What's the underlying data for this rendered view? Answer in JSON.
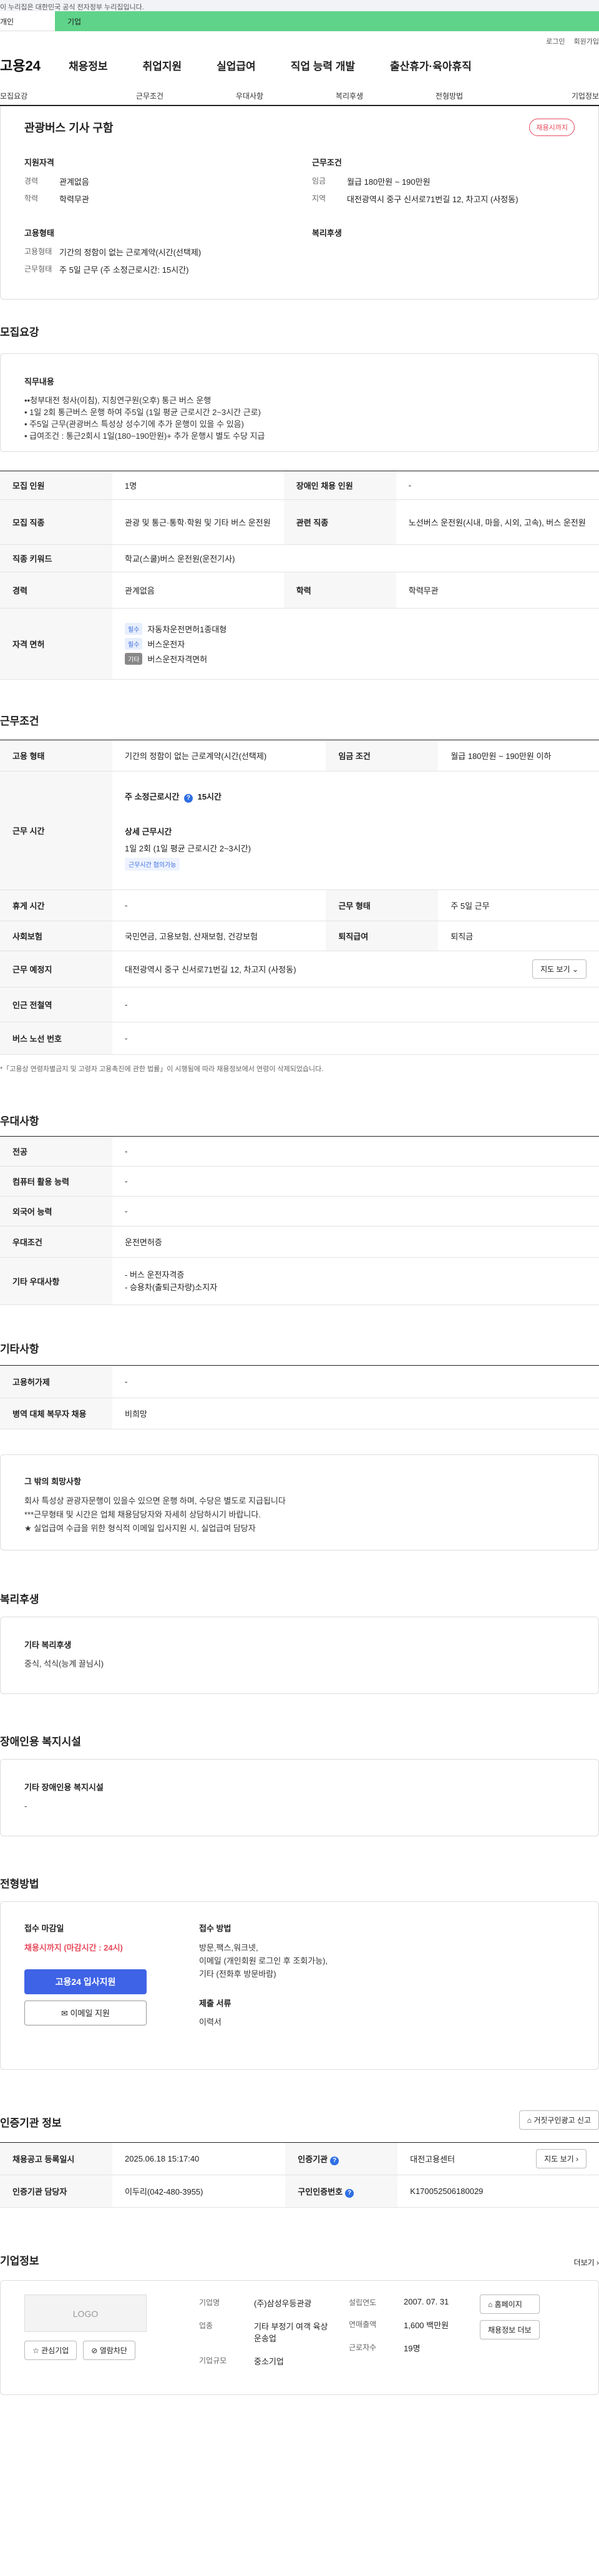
{
  "gov_banner": "이 누리집은 대한민국 공식 전자정부 누리집입니다.",
  "tabs": {
    "personal": "개인",
    "company": "기업"
  },
  "util": {
    "login": "로그인",
    "signup": "회원가입"
  },
  "logo": "고용24",
  "gnb": [
    "채용정보",
    "취업지원",
    "실업급여",
    "직업 능력 개발",
    "출산휴가·육아휴직"
  ],
  "subnav": [
    "모집요강",
    "근무조건",
    "우대사항",
    "복리후생",
    "전형방법",
    "기업정보"
  ],
  "summary": {
    "title": "관광버스 기사 구함",
    "status": "채용시까지",
    "qual": {
      "heading": "지원자격",
      "rows": [
        {
          "k": "경력",
          "v": "관계없음"
        },
        {
          "k": "학력",
          "v": "학력무관"
        }
      ]
    },
    "cond": {
      "heading": "근무조건",
      "rows": [
        {
          "k": "임금",
          "v": "월급 180만원 ~ 190만원"
        },
        {
          "k": "지역",
          "v": "대전광역시 중구 신서로71번길 12, 차고지 (사정동)"
        }
      ]
    },
    "emp": {
      "heading": "고용형태",
      "rows": [
        {
          "k": "고용형태",
          "v": "기간의 정함이 없는 근로계약(시간(선택제)"
        },
        {
          "k": "근무형태",
          "v": "주 5일 근무 (주 소정근로시간: 15시간)"
        }
      ]
    },
    "welfare": {
      "heading": "복리후생"
    }
  },
  "recruit": {
    "heading": "모집요강",
    "duty_heading": "직무내용",
    "duty_lines": [
      "••청부대전 청사(이침), 지칭연구원(오후) 통근 버스 운행",
      "• 1일 2회 통근버스 운행 하여 주5일 (1일 평균 근로시간 2~3시간 근로)",
      "• 주5일 근무(관광버스 특성상 성수기에 추가 운행이 있을 수 있음)",
      "• 급여조건 : 통근2회시 1일(180~190만원)+ 추가 운행시 별도 수당 지급"
    ],
    "count_k": "모집 인원",
    "count_v": "1명",
    "disabled_k": "장애인 채용 인원",
    "disabled_v": "-",
    "job_k": "모집 직종",
    "job_v": "관광 및 통근·통학·학원 및 기타 버스 운전원",
    "related_k": "관련 직종",
    "related_v": "노선버스 운전원(시내, 마을, 시외, 고속), 버스 운전원",
    "keyword_k": "직종 키워드",
    "keyword_v": "학교(스쿨)버스 운전원(운전기사)",
    "career_k": "경력",
    "career_v": "관계없음",
    "edu_k": "학력",
    "edu_v": "학력무관",
    "license_k": "자격 면허",
    "licenses": [
      {
        "tag": "필수",
        "name": "자동차운전면허1종대형"
      },
      {
        "tag": "필수",
        "name": "버스운전자"
      },
      {
        "tag": "기타",
        "name": "버스운전자격면허"
      }
    ]
  },
  "work": {
    "heading": "근무조건",
    "emp_k": "고용 형태",
    "emp_v": "기간의 정함이 없는 근로계약(시간(선택제)",
    "wage_k": "임금 조건",
    "wage_v": "월급 180만원 ~ 190만원 이하",
    "hours_k": "근무 시간",
    "hours_label": "주 소정근로시간",
    "hours_value": "15시간",
    "hours_detail_h": "상세 근무시간",
    "hours_detail": "1일 2회 (1일 평균 근로시간 2~3시간)",
    "hours_tag": "근무시간 협의가능",
    "rest_k": "휴게 시간",
    "rest_v": "-",
    "form_k": "근무 형태",
    "form_v": "주 5일 근무",
    "ins_k": "사회보험",
    "ins_v": "국민연금, 고용보험, 산재보험, 건강보험",
    "retire_k": "퇴직급여",
    "retire_v": "퇴직금",
    "place_k": "근무 예정지",
    "place_v": "대전광역시 중구 신서로71번길 12, 차고지 (사정동)",
    "map_btn": "지도 보기",
    "subway_k": "인근 전철역",
    "subway_v": "-",
    "bus_k": "버스 노선 번호",
    "bus_v": "-",
    "note": "*「고용상 연령차별금지 및 고령자 고용촉진에 관한 법률」이 시행됨에 따라 채용정보에서 연령이 삭제되었습니다."
  },
  "pref": {
    "heading": "우대사항",
    "rows": [
      {
        "k": "전공",
        "v": "-"
      },
      {
        "k": "컴퓨터 활용 능력",
        "v": "-"
      },
      {
        "k": "외국어 능력",
        "v": "-"
      },
      {
        "k": "우대조건",
        "v": "운전면허증"
      }
    ],
    "etc_k": "기타 우대사항",
    "etc_lines": [
      "- 버스 운전자격증",
      "- 승용차(출퇴근차량)소지자"
    ]
  },
  "other": {
    "heading": "기타사항",
    "rows": [
      {
        "k": "고용허가제",
        "v": "-"
      },
      {
        "k": "병역 대체 복무자 채용",
        "v": "비희망"
      }
    ],
    "extra_h": "그 밖의 희망사항",
    "extra_lines": [
      "회사 특성상 관광자문행이 있을수 있으면 운행 하며, 수당은 별도로 지급됩니다",
      "***근무형태 및 시간은 업체 채용담당자와 자세히 상담하시기 바랍니다.",
      "★ 실업급여 수급을 위한 형식적 이메일 입사지원 시, 실업급여 담당자"
    ]
  },
  "welfare": {
    "heading": "복리후생",
    "box_h": "기타 복리후생",
    "box_v": "중식, 석식(능계 끌님시)"
  },
  "facility": {
    "heading": "장애인용 복지시설",
    "box_h": "기타 장애인용 복지시설",
    "box_v": "-"
  },
  "apply": {
    "heading": "전형방법",
    "deadline_h": "접수 마감일",
    "deadline_v": "채용시까지 (마감시간 : 24시)",
    "btn_apply": "고용24 입사지원",
    "btn_email": "이메일 지원",
    "method_h": "접수 방법",
    "method_lines": [
      "방문,팩스,워크넷,",
      "이메일 (개인회원 로그인 후 조회가능),",
      "기타 (전화후 방문바람)"
    ],
    "docs_h": "제출 서류",
    "docs_v": "이력서"
  },
  "cert": {
    "heading": "인증기관 정보",
    "report_btn": "거짓구인광고 신고",
    "reg_k": "채용공고 등록일시",
    "reg_v": "2025.06.18 15:17:40",
    "org_k": "인증기관",
    "org_v": "대전고용센터",
    "map_btn": "지도 보기",
    "mgr_k": "인증기관 담당자",
    "mgr_v": "이두리(042-480-3955)",
    "no_k": "구인인증번호",
    "no_v": "K170052506180029"
  },
  "company": {
    "heading": "기업정보",
    "more": "더보기",
    "logo": "LOGO",
    "fav_btn": "관심기업",
    "block_btn": "열람차단",
    "name_k": "기업명",
    "name_v": "(주)삼성우등관광",
    "ind_k": "업종",
    "ind_v": "기타 부정기 여객 육상 운송업",
    "size_k": "기업규모",
    "size_v": "중소기업",
    "est_k": "설립연도",
    "est_v": "2007. 07. 31",
    "sales_k": "연매출액",
    "sales_v": "1,600 백만원",
    "emp_k": "근로자수",
    "emp_v": "19명",
    "home_btn": "홈페이지",
    "jobs_btn": "채용정보 더보"
  }
}
